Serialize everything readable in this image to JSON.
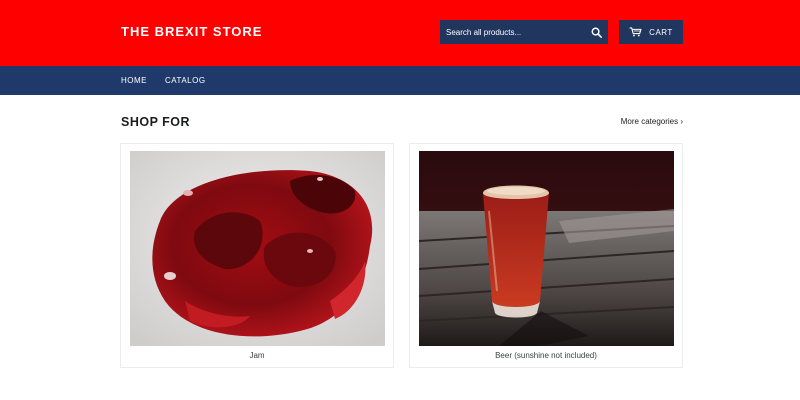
{
  "header": {
    "store_name": "THE BREXIT STORE",
    "search_placeholder": "Search all products...",
    "search_icon": "magnifier-icon",
    "cart_icon": "shopping-cart-icon",
    "cart_label": "CART",
    "colors": {
      "header_bg": "#ff0000",
      "control_bg": "#20365f"
    }
  },
  "nav": {
    "items": [
      {
        "label": "HOME"
      },
      {
        "label": "CATALOG"
      }
    ],
    "bg": "#1f3a6a"
  },
  "main": {
    "section_title": "SHOP FOR",
    "more_link": "More categories ›",
    "collections": [
      {
        "title": "Jam",
        "image": "jam-photo"
      },
      {
        "title": "Beer (sunshine not included)",
        "image": "beer-photo"
      }
    ]
  }
}
